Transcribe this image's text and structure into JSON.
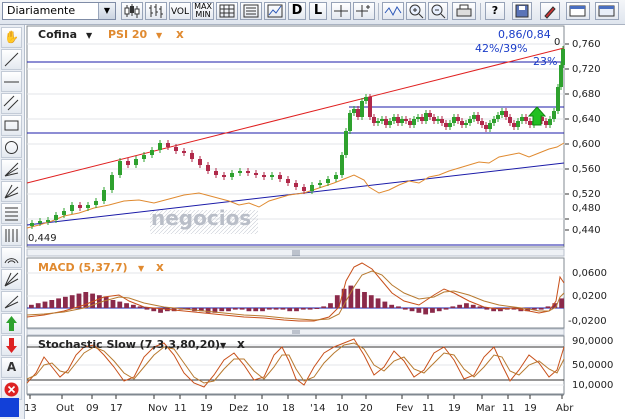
{
  "toolbar": {
    "period": "Diariamente",
    "vol_label": "VOL",
    "maxmin_label_1": "MAX",
    "maxmin_label_2": "MIN",
    "d_label": "D",
    "l_label": "L",
    "help_label": "?"
  },
  "main_panel": {
    "ticker": "Cofina",
    "overlay": "PSI 20",
    "bid_ask": "0,86/0,84",
    "pct": "42%/39%",
    "pct2": "23%",
    "marker": "0",
    "low_label": "0,449",
    "watermark": "negocios",
    "y_ticks": [
      "0,760",
      "0,720",
      "0,680",
      "0,640",
      "0,600",
      "0,560",
      "0,520",
      "0,480",
      "0,440"
    ]
  },
  "macd_panel": {
    "title": "MACD (5,37,7)",
    "y_ticks": [
      "0,0600",
      "0,0200",
      "-0,0200"
    ]
  },
  "stoch_panel": {
    "title": "Stochastic Slow (7,3,3,80,20)",
    "y_ticks": [
      "90,0000",
      "50,0000",
      "10,0000"
    ]
  },
  "x_axis": {
    "labels": [
      "13",
      "Out",
      "09",
      "17",
      "Nov",
      "11",
      "19",
      "Dez",
      "10",
      "18",
      "'14",
      "10",
      "20",
      "Fev",
      "11",
      "19",
      "Mar",
      "11",
      "19",
      "Abr"
    ]
  },
  "colors": {
    "up_candle": "#2ea12e",
    "down_candle": "#b0294a",
    "trend_red": "#e02020",
    "trend_blue": "#1b1ba8",
    "psi_line": "#e08a30",
    "accent_blue": "#1a3cc8"
  }
}
